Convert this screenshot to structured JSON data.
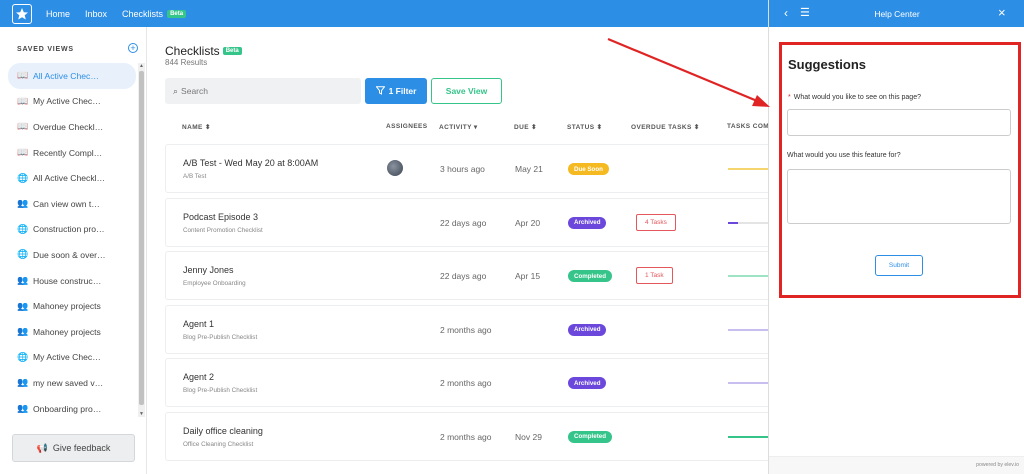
{
  "topbar": {
    "nav": [
      "Home",
      "Inbox",
      "Checklists"
    ],
    "beta": "Beta"
  },
  "sidebar": {
    "heading": "SAVED VIEWS",
    "add_icon": "plus-circle-icon",
    "items": [
      {
        "label": "All Active Chec…",
        "icon": "book-icon",
        "glyph": "📖"
      },
      {
        "label": "My Active Chec…",
        "icon": "book-icon",
        "glyph": "📖"
      },
      {
        "label": "Overdue Checkl…",
        "icon": "book-icon",
        "glyph": "📖"
      },
      {
        "label": "Recently Compl…",
        "icon": "book-icon",
        "glyph": "📖"
      },
      {
        "label": "All Active Checkl…",
        "icon": "globe-icon",
        "glyph": "🌐"
      },
      {
        "label": "Can view own t…",
        "icon": "users-icon",
        "glyph": "👥"
      },
      {
        "label": "Construction pro…",
        "icon": "globe-icon",
        "glyph": "🌐"
      },
      {
        "label": "Due soon & over…",
        "icon": "globe-icon",
        "glyph": "🌐"
      },
      {
        "label": "House construc…",
        "icon": "users-icon",
        "glyph": "👥"
      },
      {
        "label": "Mahoney projects",
        "icon": "users-icon",
        "glyph": "👥"
      },
      {
        "label": "Mahoney projects",
        "icon": "users-icon",
        "glyph": "👥"
      },
      {
        "label": "My Active Chec…",
        "icon": "globe-icon",
        "glyph": "🌐"
      },
      {
        "label": "my new saved v…",
        "icon": "users-icon",
        "glyph": "👥"
      },
      {
        "label": "Onboarding pro…",
        "icon": "users-icon",
        "glyph": "👥"
      }
    ],
    "feedback": "Give feedback"
  },
  "main": {
    "title": "Checklists",
    "beta": "Beta",
    "results": "844 Results",
    "search_placeholder": "Search",
    "filter_label": "1 Filter",
    "save_view_label": "Save View",
    "columns": {
      "name": "NAME ⬍",
      "assignees": "ASSIGNEES",
      "activity": "ACTIVITY ▾",
      "due": "DUE ⬍",
      "status": "STATUS ⬍",
      "overdue": "OVERDUE TASKS ⬍",
      "tasks": "TASKS COMPLETED"
    },
    "rows": [
      {
        "name": "A/B Test - Wed May 20 at 8:00AM",
        "sub": "A/B Test",
        "avatar": true,
        "activity": "3 hours ago",
        "due": "May 21",
        "status": "Due Soon",
        "status_color": "#f5b921",
        "overdue": "",
        "progress": 0.0,
        "bar_color": "#f5d66e"
      },
      {
        "name": "Podcast Episode 3",
        "sub": "Content Promotion Checklist",
        "avatar": false,
        "activity": "22 days ago",
        "due": "Apr 20",
        "status": "Archived",
        "status_color": "#6b48db",
        "overdue": "4 Tasks",
        "progress": 0.25,
        "bar_color": "#6b48db"
      },
      {
        "name": "Jenny Jones",
        "sub": "Employee Onboarding",
        "avatar": false,
        "activity": "22 days ago",
        "due": "Apr 15",
        "status": "Completed",
        "status_color": "#35c489",
        "overdue": "1 Task",
        "progress": 0.0,
        "bar_color": "#9fe3c5"
      },
      {
        "name": "Agent 1",
        "sub": "Blog Pre-Publish Checklist",
        "avatar": false,
        "activity": "2 months ago",
        "due": "",
        "status": "Archived",
        "status_color": "#6b48db",
        "overdue": "",
        "progress": 0.0,
        "bar_color": "#c9bef0"
      },
      {
        "name": "Agent 2",
        "sub": "Blog Pre-Publish Checklist",
        "avatar": false,
        "activity": "2 months ago",
        "due": "",
        "status": "Archived",
        "status_color": "#6b48db",
        "overdue": "",
        "progress": 0.0,
        "bar_color": "#c9bef0"
      },
      {
        "name": "Daily office cleaning",
        "sub": "Office Cleaning Checklist",
        "avatar": false,
        "activity": "2 months ago",
        "due": "Nov 29",
        "status": "Completed",
        "status_color": "#35c489",
        "overdue": "",
        "progress": 1.0,
        "bar_color": "#35c489"
      }
    ]
  },
  "help": {
    "title": "Help Center",
    "heading": "Suggestions",
    "required_mark": "*",
    "q1": "What would you like to see on this page?",
    "q2": "What would you use this feature for?",
    "submit": "Submit",
    "powered": "powered by elev.io",
    "highlight_color": "#e02424"
  }
}
